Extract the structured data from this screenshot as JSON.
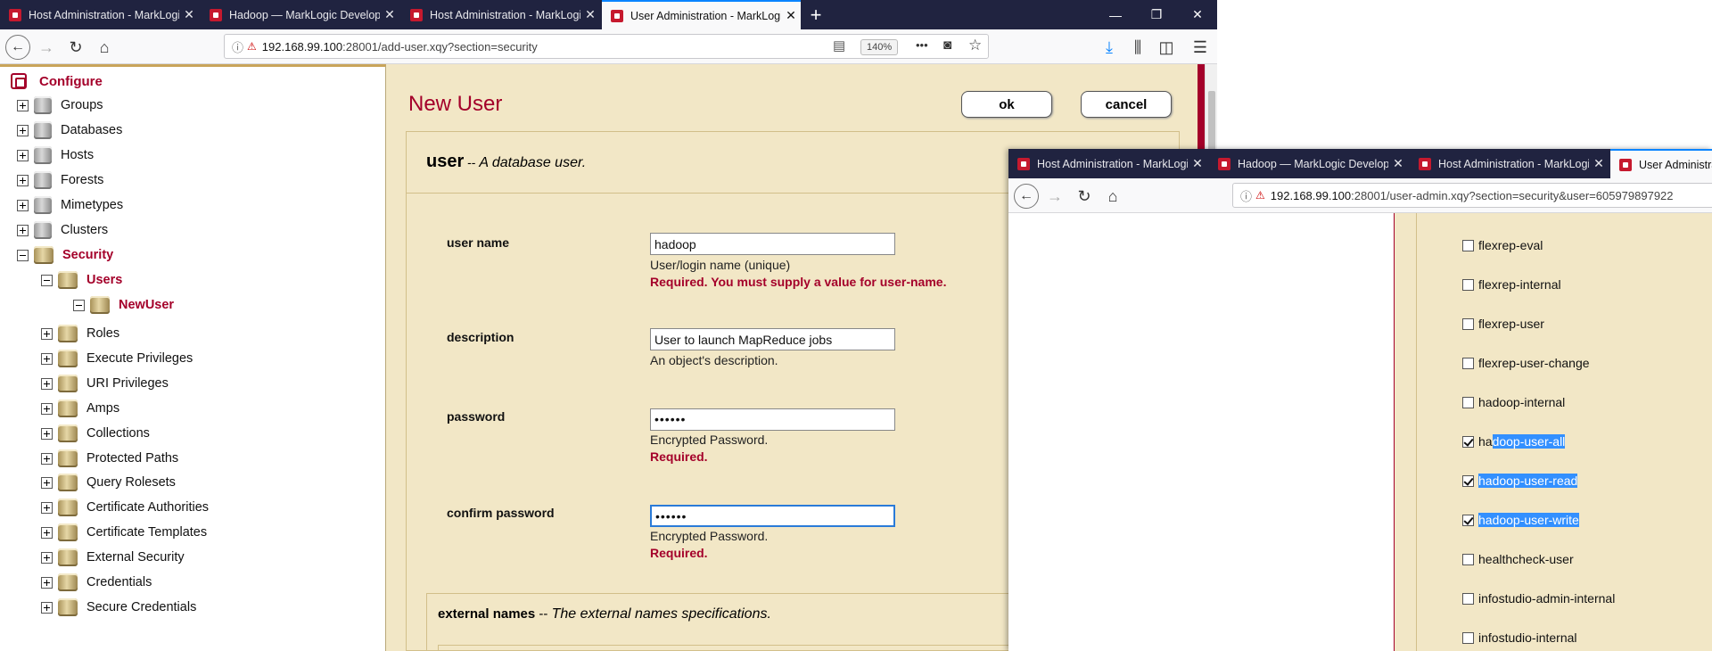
{
  "window1": {
    "tabs": [
      {
        "title": "Host Administration - MarkLogic"
      },
      {
        "title": "Hadoop — MarkLogic Developer"
      },
      {
        "title": "Host Administration - MarkLogic"
      },
      {
        "title": "User Administration - MarkLogic"
      }
    ],
    "new_tab": "+",
    "controls": {
      "minimize": "—",
      "restore": "❐",
      "close": "✕"
    },
    "nav": {
      "back": "←",
      "forward": "→",
      "reload": "↻",
      "home": "⌂",
      "url_info": "ⓘ",
      "url_insecure": "⚠",
      "url_host": "192.168.99.100",
      "url_rest": ":28001/add-user.xqy?section=security",
      "reader": "▤",
      "zoom": "140%",
      "more": "•••",
      "pocket": "◙",
      "bookmark": "☆",
      "download": "⤓",
      "library": "⫼",
      "sidebar": "◫",
      "menu": "☰"
    },
    "tree": {
      "configure": "Configure",
      "items": [
        {
          "label": "Groups"
        },
        {
          "label": "Databases"
        },
        {
          "label": "Hosts"
        },
        {
          "label": "Forests"
        },
        {
          "label": "Mimetypes"
        },
        {
          "label": "Clusters"
        },
        {
          "label": "Security"
        },
        {
          "label": "Users"
        },
        {
          "label": "NewUser"
        },
        {
          "label": "Roles"
        },
        {
          "label": "Execute Privileges"
        },
        {
          "label": "URI Privileges"
        },
        {
          "label": "Amps"
        },
        {
          "label": "Collections"
        },
        {
          "label": "Protected Paths"
        },
        {
          "label": "Query Rolesets"
        },
        {
          "label": "Certificate Authorities"
        },
        {
          "label": "Certificate Templates"
        },
        {
          "label": "External Security"
        },
        {
          "label": "Credentials"
        },
        {
          "label": "Secure Credentials"
        }
      ]
    },
    "form": {
      "title": "New User",
      "ok": "ok",
      "cancel": "cancel",
      "section_name": "user",
      "section_sep": "--",
      "section_desc": "A database user.",
      "fields": {
        "username": {
          "label": "user name",
          "value": "hadoop",
          "help": "User/login name (unique)",
          "error": "Required. You must supply a value for user-name."
        },
        "description": {
          "label": "description",
          "value": "User to launch MapReduce jobs",
          "help": "An object's description."
        },
        "password": {
          "label": "password",
          "value": "••••••",
          "help": "Encrypted Password.",
          "error": "Required."
        },
        "confirm": {
          "label": "confirm password",
          "value": "••••••",
          "help": "Encrypted Password.",
          "error": "Required."
        }
      },
      "external_name": "external names",
      "external_sep": "--",
      "external_desc": "The external names specifications."
    }
  },
  "window2": {
    "tabs": [
      {
        "title": "Host Administration - MarkLogic"
      },
      {
        "title": "Hadoop — MarkLogic Developer"
      },
      {
        "title": "Host Administration - MarkLogic"
      },
      {
        "title": "User Administratio"
      }
    ],
    "nav": {
      "back": "←",
      "forward": "→",
      "reload": "↻",
      "home": "⌂",
      "url_info": "ⓘ",
      "url_insecure": "⚠",
      "url_host": "192.168.99.100",
      "url_rest": ":28001/user-admin.xqy?section=security&user=605979897922"
    },
    "roles": [
      {
        "name": "flexrep-eval",
        "checked": false
      },
      {
        "name": "flexrep-internal",
        "checked": false
      },
      {
        "name": "flexrep-user",
        "checked": false
      },
      {
        "name": "flexrep-user-change",
        "checked": false
      },
      {
        "name": "hadoop-internal",
        "checked": false
      },
      {
        "name_a": "ha",
        "name_b": "doop-user-all",
        "checked": true
      },
      {
        "name": "hadoop-user-read",
        "checked": true
      },
      {
        "name": "hadoop-user-write",
        "checked": true
      },
      {
        "name": "healthcheck-user",
        "checked": false
      },
      {
        "name": "infostudio-admin-internal",
        "checked": false
      },
      {
        "name": "infostudio-internal",
        "checked": false
      }
    ]
  },
  "colors": {
    "accent": "#a4002a",
    "panel": "#f2e7c6",
    "tabbar": "#202340",
    "selection": "#3390ff"
  }
}
